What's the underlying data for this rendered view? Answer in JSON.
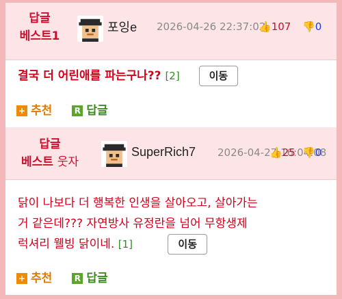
{
  "comments": [
    {
      "badge_line1": "답글",
      "badge_line2": "베스트1",
      "badge_sub": "",
      "nickname": "포잉e",
      "date": "2026-04-26 22:37:02",
      "up_count": "107",
      "down_count": "0",
      "text": "결국 더 어린애를 파는구나??",
      "reply_count": "[2]",
      "move_label": "이동",
      "recommend_label": "추천",
      "reply_label": "답글",
      "text_bold": true
    },
    {
      "badge_line1": "답글",
      "badge_line2": "베스트",
      "badge_sub": "웃자",
      "nickname": "SuperRich7",
      "date": "2026-04-27 16:04:08",
      "up_count": "25",
      "down_count": "0",
      "text_lines": [
        "닭이 나보다 더 행복한 인생을 살아오고, 살아가는",
        "거 같은데??? 자연방사 유정란을 넘어 무항생제",
        "럭셔리 웰빙 닭이네."
      ],
      "reply_count": "[1]",
      "move_label": "이동",
      "recommend_label": "추천",
      "reply_label": "답글",
      "text_bold": false
    }
  ],
  "icons": {
    "recommend_icon": "+",
    "reply_icon": "R",
    "thumb_up": "thumbs-up-icon",
    "thumb_down": "thumbs-down-icon"
  },
  "colors": {
    "accent_red": "#c8102e",
    "header_bg": "#fde4e6",
    "page_bg": "#f4b8bb",
    "reply_green": "#3a8c1e",
    "recommend_orange": "#e07a00"
  }
}
